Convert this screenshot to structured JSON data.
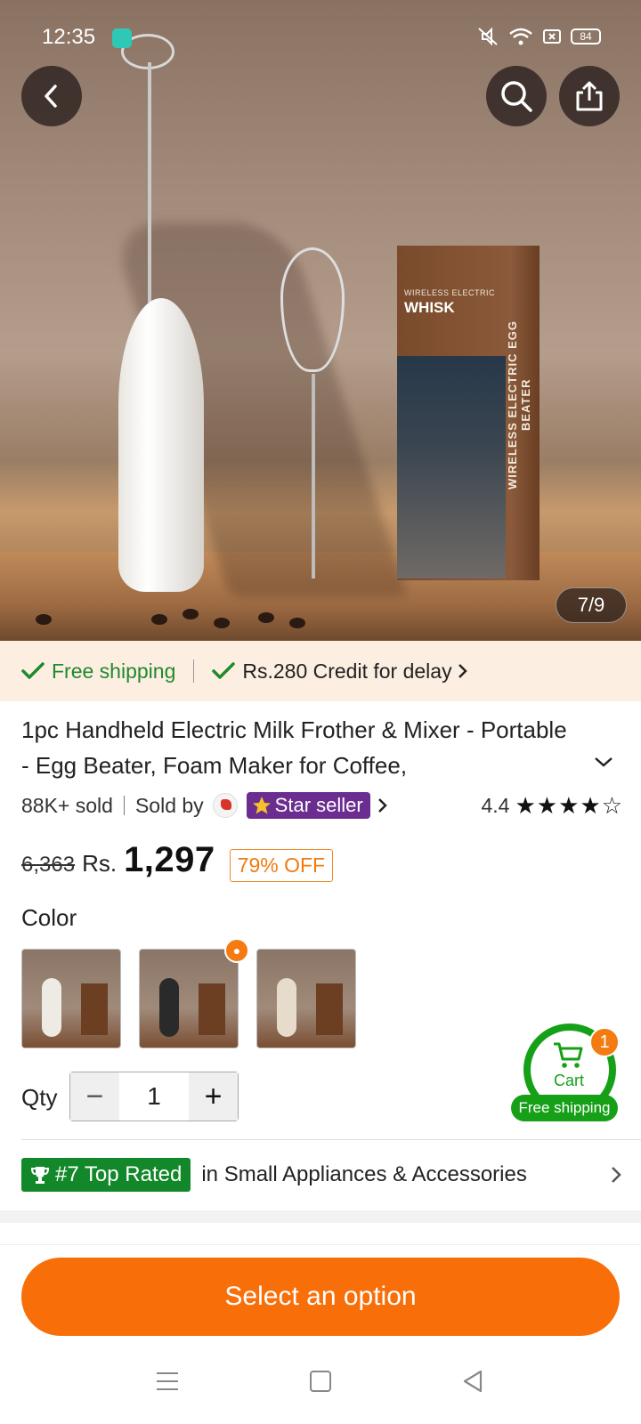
{
  "status": {
    "time": "12:35",
    "battery": "84"
  },
  "hero": {
    "box_line1": "WIRELESS ELECTRIC",
    "box_line2": "WHISK",
    "box_side": "WIRELESS ELECTRIC EGG BEATER",
    "page_indicator": "7/9"
  },
  "shipping": {
    "free": "Free shipping",
    "credit": "Rs.280 Credit for delay"
  },
  "product": {
    "title": "1pc Handheld Electric Milk Frother & Mixer - Portable - Egg Beater, Foam Maker for Coffee,",
    "sold": "88K+ sold",
    "sold_by": "Sold by",
    "star_seller": "Star seller",
    "rating": "4.4",
    "stars": "★★★★☆",
    "old_price": "6,363",
    "currency": "Rs.",
    "price": "1,297",
    "discount": "79% OFF"
  },
  "color": {
    "label": "Color",
    "options": [
      "White",
      "Black",
      "Beige"
    ]
  },
  "qty": {
    "label": "Qty",
    "value": "1",
    "minus": "−",
    "plus": "+"
  },
  "cart": {
    "label": "Cart",
    "count": "1",
    "free_shipping": "Free shipping"
  },
  "top_rated": {
    "badge": "#7 Top Rated",
    "text": "in Small Appliances & Accessories"
  },
  "cta": {
    "label": "Select an option"
  },
  "colors": {
    "accent": "#f86f0a",
    "green": "#16a017",
    "star_seller": "#6b2d8f"
  }
}
